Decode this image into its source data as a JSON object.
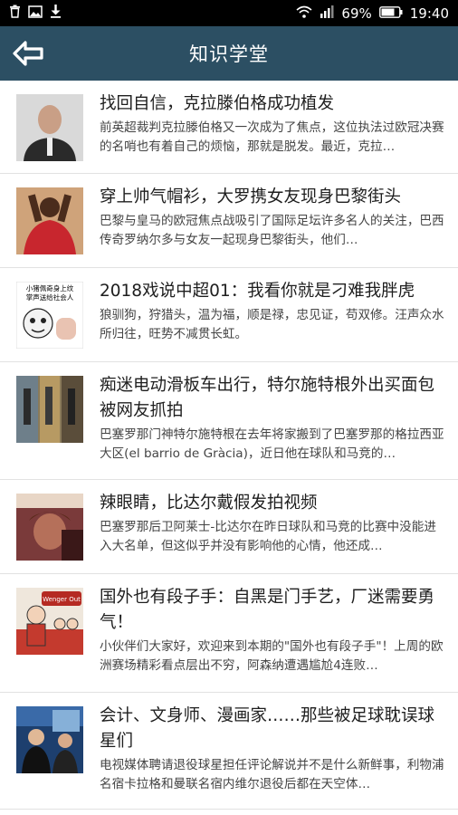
{
  "status_bar": {
    "battery": "69%",
    "time": "19:40",
    "icons_left": [
      "trash-icon",
      "image-icon",
      "download-icon"
    ],
    "icons_right": [
      "wifi-icon",
      "signal-icon",
      "battery-icon"
    ]
  },
  "header": {
    "title": "知识学堂",
    "back_icon": "back-arrow-icon"
  },
  "articles": [
    {
      "title": "找回自信，克拉滕伯格成功植发",
      "summary": "前英超裁判克拉滕伯格又一次成为了焦点，这位执法过欧冠决赛的名哨也有着自己的烦恼，那就是脱发。最近，克拉…"
    },
    {
      "title": "穿上帅气帽衫，大罗携女友现身巴黎街头",
      "summary": "巴黎与皇马的欧冠焦点战吸引了国际足坛许多名人的关注，巴西传奇罗纳尔多与女友一起现身巴黎街头，他们…"
    },
    {
      "title": "2018戏说中超01：我看你就是刁难我胖虎",
      "summary": "狼驯狗，狩猎头，温为福，顺是禄，忠见证，苟双修。汪声众水所归往，旺势不减贯长虹。",
      "thumb_text": [
        "小猪佩奇身上纹",
        "掌声送给社会人"
      ]
    },
    {
      "title": "痴迷电动滑板车出行，特尔施特根外出买面包被网友抓拍",
      "summary": "巴塞罗那门神特尔施特根在去年将家搬到了巴塞罗那的格拉西亚大区(el barrio de Gràcia)，近日他在球队和马竞的…"
    },
    {
      "title": "辣眼睛，比达尔戴假发拍视频",
      "summary": "巴塞罗那后卫阿莱士-比达尔在昨日球队和马竞的比赛中没能进入大名单，但这似乎并没有影响他的心情，他还成…"
    },
    {
      "title": "国外也有段子手：自黑是门手艺，厂迷需要勇气！",
      "summary": "小伙伴们大家好，欢迎来到本期的\"国外也有段子手\"！上周的欧洲赛场精彩看点层出不穷，阿森纳遭遇尴尬4连败…",
      "thumb_text": [
        "Wenger Out"
      ]
    },
    {
      "title": "会计、文身师、漫画家……那些被足球耽误球星们",
      "summary": "电视媒体聘请退役球星担任评论解说并不是什么新鲜事，利物浦名宿卡拉格和曼联名宿内维尔退役后都在天空体…"
    }
  ]
}
